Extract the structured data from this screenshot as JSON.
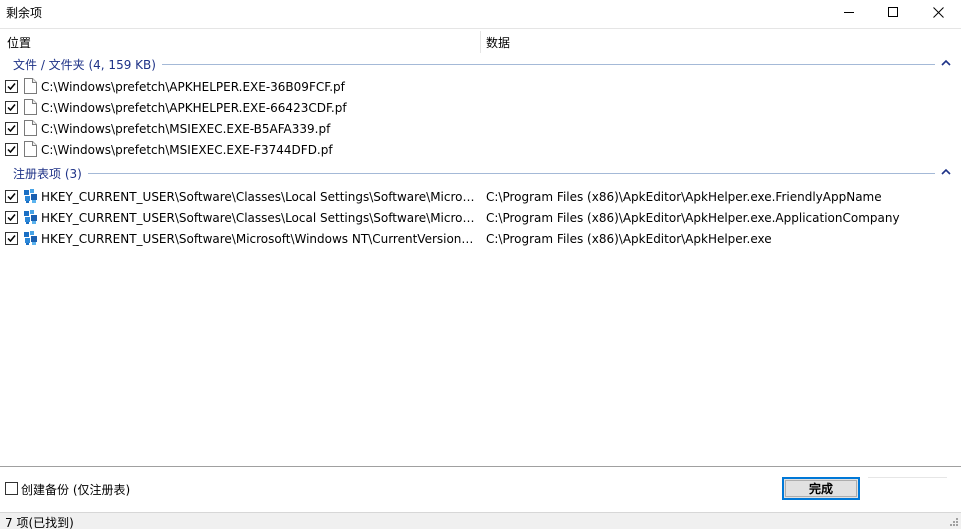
{
  "window": {
    "title": "剩余项"
  },
  "columns": {
    "location": "位置",
    "data": "数据"
  },
  "groups": {
    "files": {
      "title": "文件 / 文件夹 (4, 159 KB)"
    },
    "registry": {
      "title": "注册表项 (3)"
    }
  },
  "files": [
    {
      "path": "C:\\Windows\\prefetch\\APKHELPER.EXE-36B09FCF.pf",
      "checked": true
    },
    {
      "path": "C:\\Windows\\prefetch\\APKHELPER.EXE-66423CDF.pf",
      "checked": true
    },
    {
      "path": "C:\\Windows\\prefetch\\MSIEXEC.EXE-B5AFA339.pf",
      "checked": true
    },
    {
      "path": "C:\\Windows\\prefetch\\MSIEXEC.EXE-F3744DFD.pf",
      "checked": true
    }
  ],
  "registry": [
    {
      "key": "HKEY_CURRENT_USER\\Software\\Classes\\Local Settings\\Software\\Microsoft\\Windows\\S...",
      "data": "C:\\Program Files (x86)\\ApkEditor\\ApkHelper.exe.FriendlyAppName",
      "checked": true
    },
    {
      "key": "HKEY_CURRENT_USER\\Software\\Classes\\Local Settings\\Software\\Microsoft\\Windows\\S...",
      "data": "C:\\Program Files (x86)\\ApkEditor\\ApkHelper.exe.ApplicationCompany",
      "checked": true
    },
    {
      "key": "HKEY_CURRENT_USER\\Software\\Microsoft\\Windows NT\\CurrentVersion\\AppCompatFla...",
      "data": "C:\\Program Files (x86)\\ApkEditor\\ApkHelper.exe",
      "checked": true
    }
  ],
  "footer": {
    "backup_label": "创建备份 (仅注册表)",
    "backup_checked": false,
    "done_label": "完成"
  },
  "status": {
    "text": "7 项(已找到)"
  },
  "colors": {
    "group_title": "#1e3287",
    "group_line": "#a4b9d7",
    "accent": "#0078d7"
  }
}
